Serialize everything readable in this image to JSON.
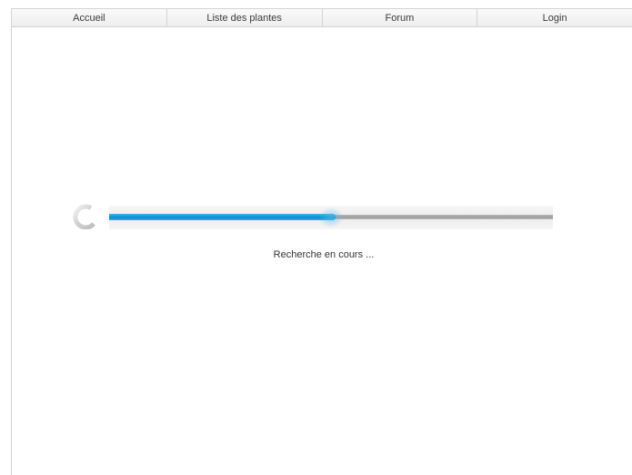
{
  "nav": {
    "items": [
      {
        "label": "Accueil"
      },
      {
        "label": "Liste des plantes"
      },
      {
        "label": "Forum"
      },
      {
        "label": "Login"
      }
    ]
  },
  "loader": {
    "status_text": "Recherche en cours ...",
    "progress": 0.51,
    "spinner_icon": "loading-spinner-icon",
    "colors": {
      "fill": "#0a8fd0",
      "rail": "#a3a3a3",
      "spinner": "#d0d0d0"
    }
  }
}
